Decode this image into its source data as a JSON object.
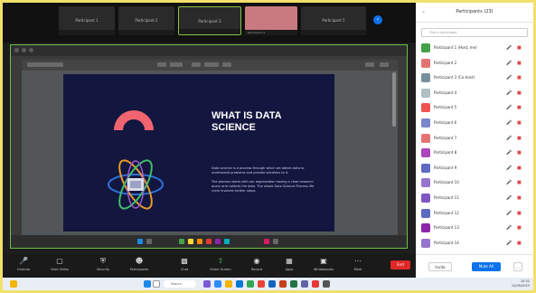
{
  "strip": {
    "tiles": [
      "Participant 1",
      "Participant 2",
      "Participant 3",
      "Participant 4",
      "Participant 5"
    ]
  },
  "slide": {
    "title": "WHAT IS DATA SCIENCE",
    "para1": "Data science is a process through which we obtain data to understand problems and provide solutions to it.",
    "para2": "The process starts with our organization having a clear research query and collects the data. The whole Data Science Process life cycle involves further steps."
  },
  "controls": {
    "items": [
      "Unmute",
      "Start Video",
      "Security",
      "Participants",
      "Chat",
      "Share Screen",
      "Record",
      "Apps",
      "Whiteboards",
      "More"
    ],
    "end": "End"
  },
  "panel": {
    "title": "Participants (23)",
    "search_placeholder": "Find a participant",
    "participants": [
      "Participant 1 (Host, me)",
      "Participant 2",
      "Participant 3 (Co-host)",
      "Participant 4",
      "Participant 5",
      "Participant 6",
      "Participant 7",
      "Participant 8",
      "Participant 9",
      "Participant 10",
      "Participant 11",
      "Participant 12",
      "Participant 13",
      "Participant 14"
    ],
    "invite": "Invite",
    "mute_all": "Mute All",
    "more": "..."
  },
  "taskbar": {
    "search": "Search",
    "time": "10:32",
    "date": "12/05/2023"
  },
  "colors": {
    "accent": "#0e72ed",
    "end": "#e02828",
    "slide_bg": "#13163e",
    "highlight": "#6fbf4a"
  }
}
